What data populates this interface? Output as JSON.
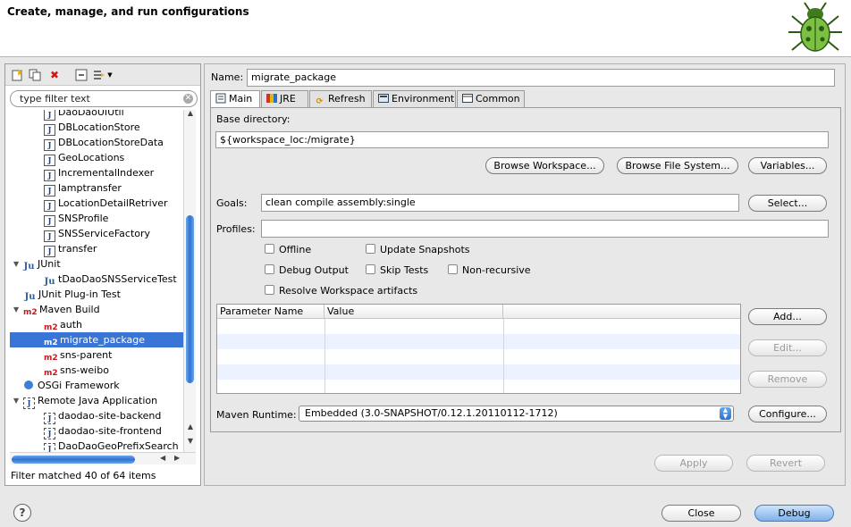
{
  "banner": {
    "title": "Create, manage, and run configurations"
  },
  "left": {
    "filter_placeholder": "type filter text",
    "tree": [
      {
        "label": "DaoDaoUIUtil",
        "icon": "java-app-icon",
        "indent": 2
      },
      {
        "label": "DBLocationStore",
        "icon": "java-app-icon",
        "indent": 2
      },
      {
        "label": "DBLocationStoreData",
        "icon": "java-app-icon",
        "indent": 2
      },
      {
        "label": "GeoLocations",
        "icon": "java-app-icon",
        "indent": 2
      },
      {
        "label": "IncrementalIndexer",
        "icon": "java-app-icon",
        "indent": 2
      },
      {
        "label": "lamptransfer",
        "icon": "java-app-icon",
        "indent": 2
      },
      {
        "label": "LocationDetailRetriver",
        "icon": "java-app-icon",
        "indent": 2
      },
      {
        "label": "SNSProfile",
        "icon": "java-app-icon",
        "indent": 2
      },
      {
        "label": "SNSServiceFactory",
        "icon": "java-app-icon",
        "indent": 2
      },
      {
        "label": "transfer",
        "icon": "java-app-icon",
        "indent": 2
      },
      {
        "label": "JUnit",
        "icon": "junit-icon",
        "indent": 0,
        "expanded": true
      },
      {
        "label": "tDaoDaoSNSServiceTest",
        "icon": "junit-icon",
        "indent": 2
      },
      {
        "label": "JUnit Plug-in Test",
        "icon": "junit-icon",
        "indent": 1
      },
      {
        "label": "Maven Build",
        "icon": "m2-icon",
        "indent": 0,
        "expanded": true
      },
      {
        "label": "auth",
        "icon": "m2-icon",
        "indent": 2
      },
      {
        "label": "migrate_package",
        "icon": "m2-icon",
        "indent": 2,
        "selected": true
      },
      {
        "label": "sns-parent",
        "icon": "m2-icon",
        "indent": 2
      },
      {
        "label": "sns-weibo",
        "icon": "m2-icon",
        "indent": 2
      },
      {
        "label": "OSGi Framework",
        "icon": "osgi-icon",
        "indent": 1
      },
      {
        "label": "Remote Java Application",
        "icon": "remote-java-icon",
        "indent": 0,
        "expanded": true
      },
      {
        "label": "daodao-site-backend",
        "icon": "remote-java-icon",
        "indent": 2
      },
      {
        "label": "daodao-site-frontend",
        "icon": "remote-java-icon",
        "indent": 2
      },
      {
        "label": "DaoDaoGeoPrefixSearch",
        "icon": "remote-java-icon",
        "indent": 2
      }
    ],
    "status": "Filter matched 40 of 64 items"
  },
  "config": {
    "name_label": "Name:",
    "name_value": "migrate_package",
    "tabs": [
      {
        "label": "Main",
        "icon": "main-tab-icon"
      },
      {
        "label": "JRE",
        "icon": "jre-icon"
      },
      {
        "label": "Refresh",
        "icon": "refresh-icon"
      },
      {
        "label": "Environment",
        "icon": "environment-icon"
      },
      {
        "label": "Common",
        "icon": "common-icon"
      }
    ],
    "base_dir_label": "Base directory:",
    "base_dir_value": "${workspace_loc:/migrate}",
    "browse_workspace": "Browse Workspace...",
    "browse_fs": "Browse File System...",
    "variables": "Variables...",
    "goals_label": "Goals:",
    "goals_value": "clean compile assembly:single",
    "select": "Select...",
    "profiles_label": "Profiles:",
    "profiles_value": "",
    "checkboxes": {
      "offline": "Offline",
      "update_snapshots": "Update Snapshots",
      "debug_output": "Debug Output",
      "skip_tests": "Skip Tests",
      "non_recursive": "Non-recursive",
      "resolve_workspace": "Resolve Workspace artifacts"
    },
    "param_headers": [
      "Parameter Name",
      "Value"
    ],
    "add": "Add...",
    "edit": "Edit...",
    "remove": "Remove",
    "runtime_label": "Maven Runtime:",
    "runtime_value": "Embedded (3.0-SNAPSHOT/0.12.1.20110112-1712)",
    "configure": "Configure...",
    "apply": "Apply",
    "revert": "Revert"
  },
  "footer": {
    "close": "Close",
    "debug": "Debug"
  }
}
